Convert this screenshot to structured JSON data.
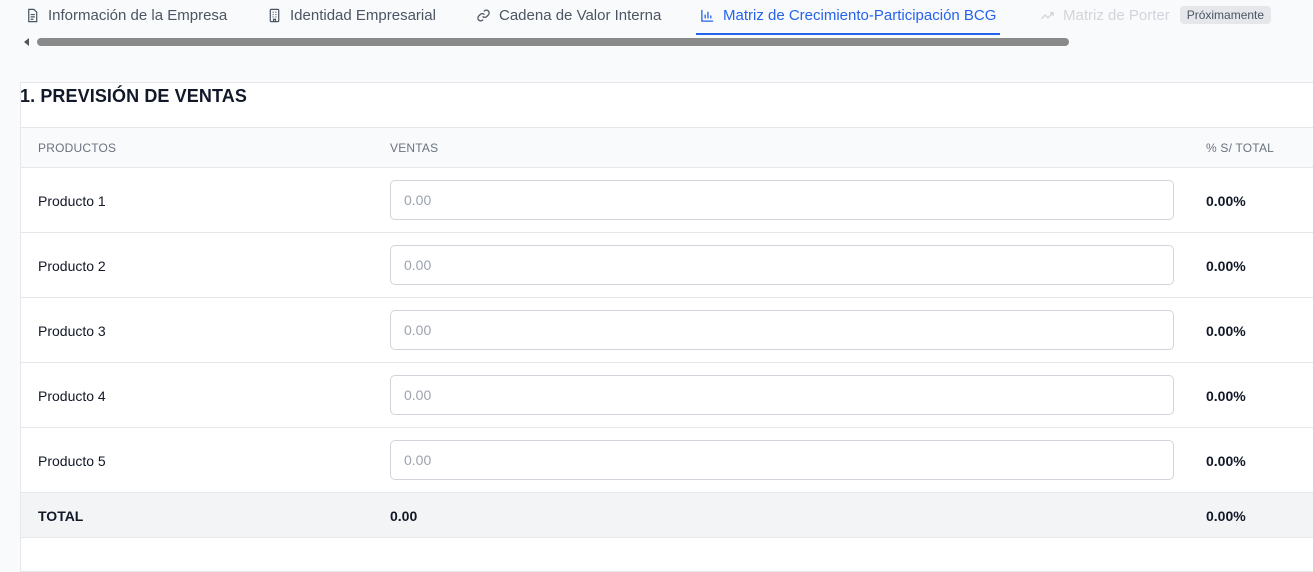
{
  "tabs": [
    {
      "label": "Información de la Empresa",
      "icon": "document-icon",
      "state": "normal"
    },
    {
      "label": "Identidad Empresarial",
      "icon": "building-icon",
      "state": "normal"
    },
    {
      "label": "Cadena de Valor Interna",
      "icon": "link-icon",
      "state": "normal"
    },
    {
      "label": "Matriz de Crecimiento-Participación BCG",
      "icon": "bar-chart-icon",
      "state": "active"
    },
    {
      "label": "Matriz de Porter",
      "icon": "trending-up-icon",
      "state": "disabled",
      "badge": "Próximamente"
    }
  ],
  "section": {
    "title": "1. PREVISIÓN DE VENTAS"
  },
  "table": {
    "headers": {
      "products": "PRODUCTOS",
      "sales": "VENTAS",
      "pct": "% S/ TOTAL"
    },
    "rows": [
      {
        "name": "Producto 1",
        "placeholder": "0.00",
        "pct": "0.00%"
      },
      {
        "name": "Producto 2",
        "placeholder": "0.00",
        "pct": "0.00%"
      },
      {
        "name": "Producto 3",
        "placeholder": "0.00",
        "pct": "0.00%"
      },
      {
        "name": "Producto 4",
        "placeholder": "0.00",
        "pct": "0.00%"
      },
      {
        "name": "Producto 5",
        "placeholder": "0.00",
        "pct": "0.00%"
      }
    ],
    "total": {
      "label": "TOTAL",
      "value": "0.00",
      "pct": "0.00%"
    }
  },
  "colors": {
    "accent": "#2563eb",
    "disabled": "#d1d5db"
  }
}
